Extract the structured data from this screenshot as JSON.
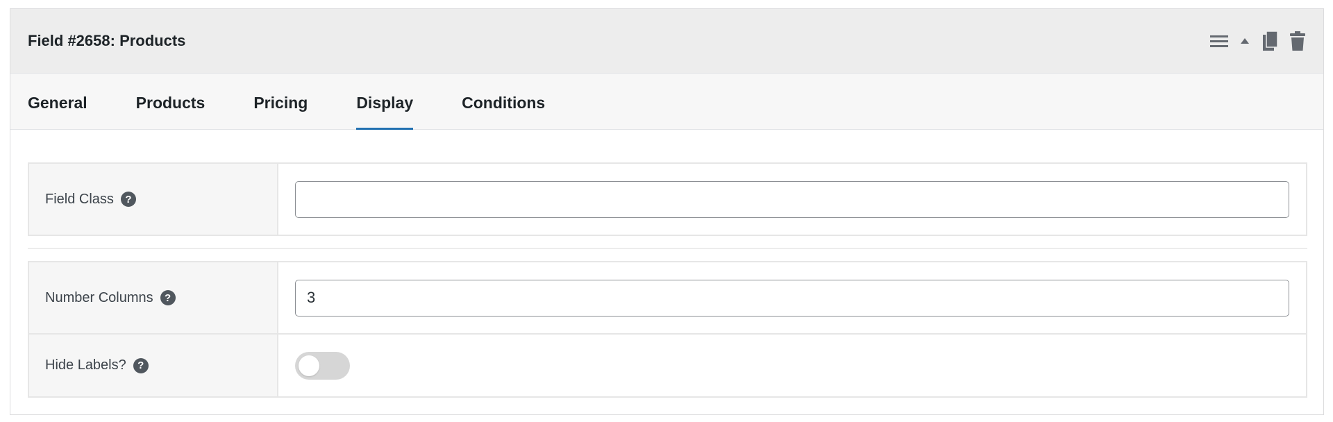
{
  "panel": {
    "title": "Field #2658: Products"
  },
  "header_actions": [
    {
      "name": "menu-icon"
    },
    {
      "name": "collapse-arrow-icon"
    },
    {
      "name": "duplicate-icon"
    },
    {
      "name": "trash-icon"
    }
  ],
  "tabs": [
    {
      "label": "General",
      "active": false
    },
    {
      "label": "Products",
      "active": false
    },
    {
      "label": "Pricing",
      "active": false
    },
    {
      "label": "Display",
      "active": true
    },
    {
      "label": "Conditions",
      "active": false
    }
  ],
  "fields": {
    "field_class": {
      "label": "Field Class",
      "value": "",
      "help": "?"
    },
    "number_columns": {
      "label": "Number Columns",
      "value": "3",
      "help": "?"
    },
    "hide_labels": {
      "label": "Hide Labels?",
      "checked": false,
      "help": "?"
    }
  },
  "colors": {
    "accent": "#2271b1",
    "header_bg": "#ededed",
    "tabs_bg": "#f7f7f7",
    "toggle_off": "#d6d6d6"
  }
}
